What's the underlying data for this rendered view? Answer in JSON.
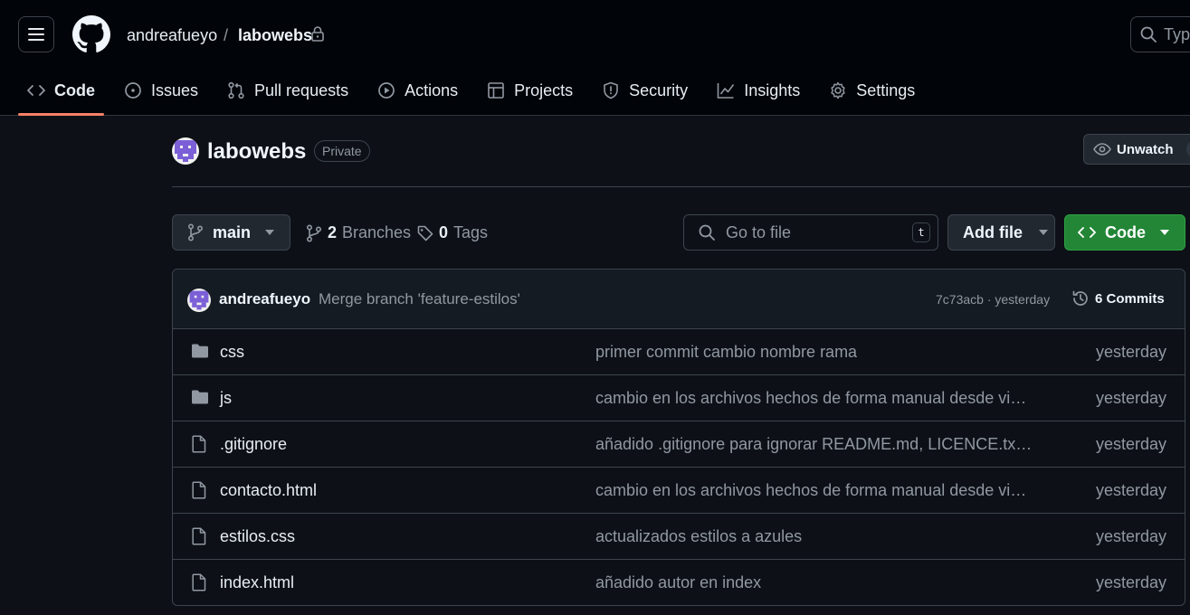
{
  "header": {
    "owner": "andreafueyo",
    "separator": "/",
    "repo": "labowebs",
    "search_placeholder": "Typ"
  },
  "tabs": [
    {
      "label": "Code",
      "icon": "code-icon",
      "active": true
    },
    {
      "label": "Issues",
      "icon": "issue-opened-icon"
    },
    {
      "label": "Pull requests",
      "icon": "git-pull-request-icon"
    },
    {
      "label": "Actions",
      "icon": "play-icon"
    },
    {
      "label": "Projects",
      "icon": "table-icon"
    },
    {
      "label": "Security",
      "icon": "shield-icon"
    },
    {
      "label": "Insights",
      "icon": "graph-icon"
    },
    {
      "label": "Settings",
      "icon": "gear-icon"
    }
  ],
  "repo": {
    "name": "labowebs",
    "visibility": "Private",
    "watch_label": "Unwatch"
  },
  "nav": {
    "branch": "main",
    "branches_count": "2",
    "branches_label": "Branches",
    "tags_count": "0",
    "tags_label": "Tags",
    "goto_placeholder": "Go to file",
    "goto_shortcut": "t",
    "add_file_label": "Add file",
    "code_label": "Code"
  },
  "latest_commit": {
    "author": "andreafueyo",
    "message": "Merge branch 'feature-estilos'",
    "hash_time": "7c73acb · yesterday",
    "commits_label": "6 Commits"
  },
  "files": [
    {
      "type": "folder",
      "name": "css",
      "message": "primer commit cambio nombre rama",
      "time": "yesterday"
    },
    {
      "type": "folder",
      "name": "js",
      "message": "cambio en los archivos hechos de forma manual desde visua...",
      "time": "yesterday"
    },
    {
      "type": "file",
      "name": ".gitignore",
      "message": "añadido .gitignore para ignorar README.md, LICENCE.txt y ...",
      "time": "yesterday"
    },
    {
      "type": "file",
      "name": "contacto.html",
      "message": "cambio en los archivos hechos de forma manual desde visua...",
      "time": "yesterday"
    },
    {
      "type": "file",
      "name": "estilos.css",
      "message": "actualizados estilos a azules",
      "time": "yesterday"
    },
    {
      "type": "file",
      "name": "index.html",
      "message": "añadido autor en index",
      "time": "yesterday"
    }
  ],
  "colors": {
    "bg": "#0d1117",
    "header_bg": "#010409",
    "accent_underline": "#f78166",
    "primary_button": "#238636",
    "avatar": "#7b5fd6"
  }
}
